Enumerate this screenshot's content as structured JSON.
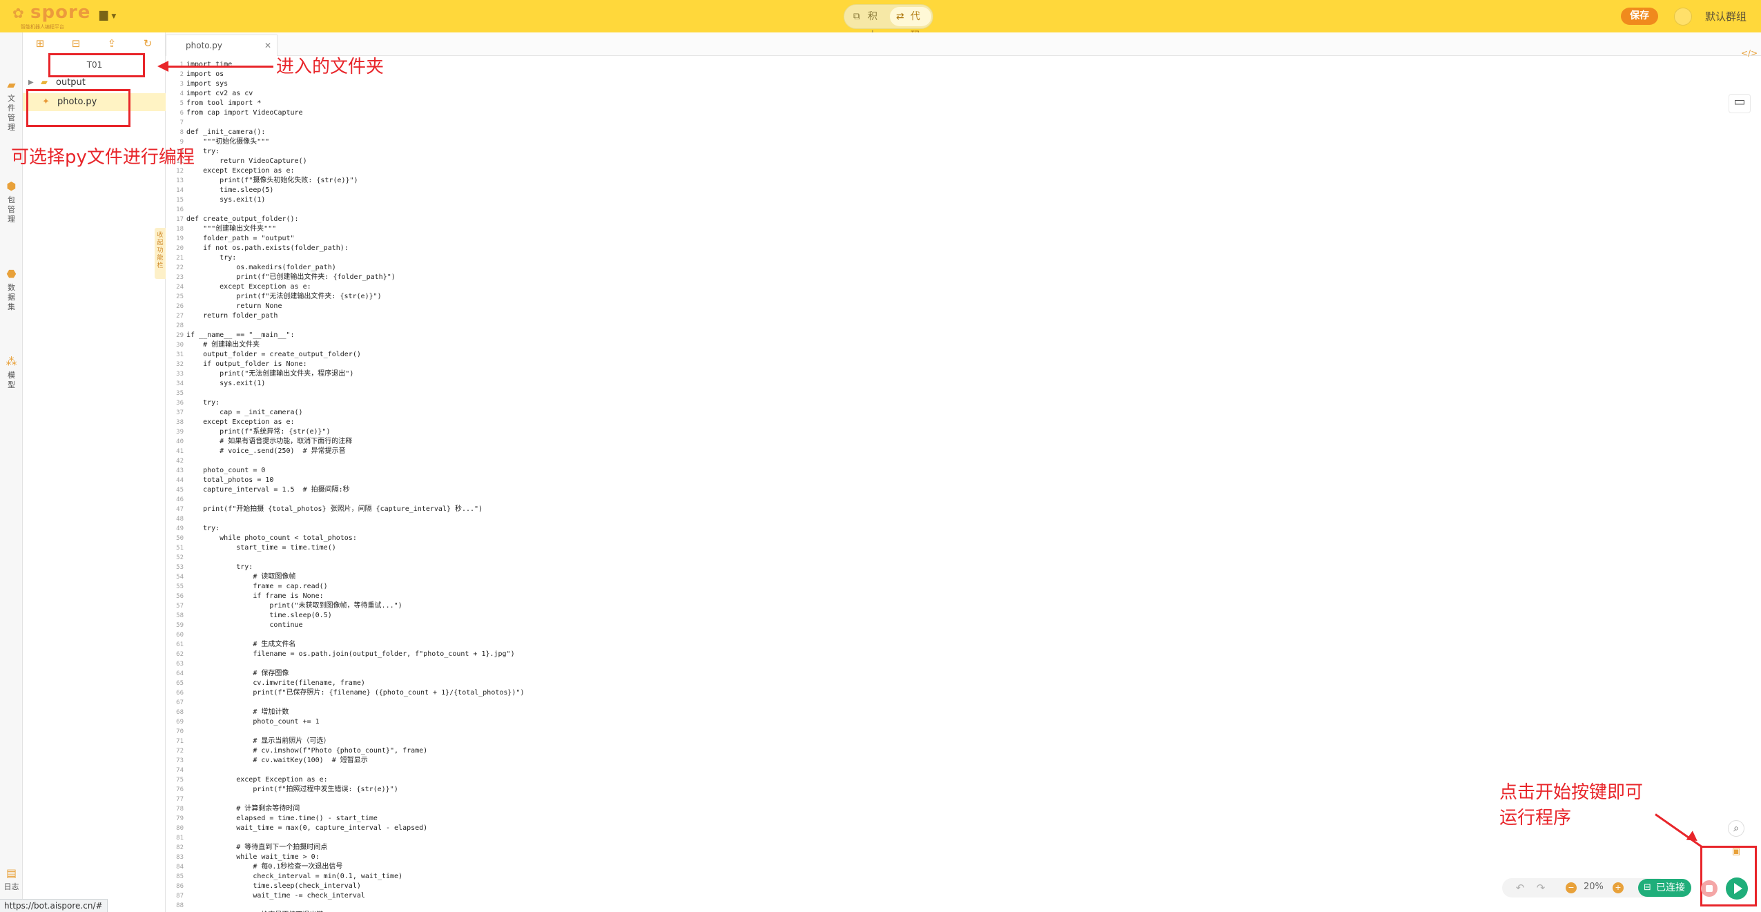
{
  "header": {
    "brand": "spore",
    "brand_sub": "智能机器人编程平台",
    "mode_blocks": "积木",
    "mode_code": "代码",
    "save_label": "保存",
    "group_label": "默认群组"
  },
  "rail": {
    "items": [
      {
        "label": "文件管理",
        "icon": "folder-icon"
      },
      {
        "label": "包管理",
        "icon": "package-icon"
      },
      {
        "label": "数据集",
        "icon": "dataset-icon"
      },
      {
        "label": "模型",
        "icon": "model-icon"
      }
    ],
    "log_label": "日志"
  },
  "files": {
    "project": "T01",
    "tree": [
      {
        "name": "output",
        "type": "folder"
      },
      {
        "name": "photo.py",
        "type": "file"
      }
    ],
    "collapse_label": "收起功能栏"
  },
  "editor": {
    "tab_name": "photo.py",
    "lines": [
      "import time",
      "import os",
      "import sys",
      "import cv2 as cv",
      "from tool import *",
      "from cap import VideoCapture",
      "",
      "def _init_camera():",
      "    \"\"\"初始化摄像头\"\"\"",
      "    try:",
      "        return VideoCapture()",
      "    except Exception as e:",
      "        print(f\"摄像头初始化失败: {str(e)}\")",
      "        time.sleep(5)",
      "        sys.exit(1)",
      "",
      "def create_output_folder():",
      "    \"\"\"创建输出文件夹\"\"\"",
      "    folder_path = \"output\"",
      "    if not os.path.exists(folder_path):",
      "        try:",
      "            os.makedirs(folder_path)",
      "            print(f\"已创建输出文件夹: {folder_path}\")",
      "        except Exception as e:",
      "            print(f\"无法创建输出文件夹: {str(e)}\")",
      "            return None",
      "    return folder_path",
      "",
      "if __name__ == \"__main__\":",
      "    # 创建输出文件夹",
      "    output_folder = create_output_folder()",
      "    if output_folder is None:",
      "        print(\"无法创建输出文件夹，程序退出\")",
      "        sys.exit(1)",
      "",
      "    try:",
      "        cap = _init_camera()",
      "    except Exception as e:",
      "        print(f\"系统异常: {str(e)}\")",
      "        # 如果有语音提示功能，取消下面行的注释",
      "        # voice_.send(250)  # 异常提示音",
      "",
      "    photo_count = 0",
      "    total_photos = 10",
      "    capture_interval = 1.5  # 拍摄间隔:秒",
      "",
      "    print(f\"开始拍摄 {total_photos} 张照片，间隔 {capture_interval} 秒...\")",
      "",
      "    try:",
      "        while photo_count < total_photos:",
      "            start_time = time.time()",
      "",
      "            try:",
      "                # 读取图像帧",
      "                frame = cap.read()",
      "                if frame is None:",
      "                    print(\"未获取到图像帧，等待重试...\")",
      "                    time.sleep(0.5)",
      "                    continue",
      "",
      "                # 生成文件名",
      "                filename = os.path.join(output_folder, f\"photo_count + 1}.jpg\")",
      "",
      "                # 保存图像",
      "                cv.imwrite(filename, frame)",
      "                print(f\"已保存照片: {filename} ({photo_count + 1}/{total_photos})\")",
      "",
      "                # 增加计数",
      "                photo_count += 1",
      "",
      "                # 显示当前照片（可选）",
      "                # cv.imshow(f\"Photo {photo_count}\", frame)",
      "                # cv.waitKey(100)  # 短暂显示",
      "",
      "            except Exception as e:",
      "                print(f\"拍照过程中发生错误: {str(e)}\")",
      "",
      "            # 计算剩余等待时间",
      "            elapsed = time.time() - start_time",
      "            wait_time = max(0, capture_interval - elapsed)",
      "",
      "            # 等待直到下一个拍摄时间点",
      "            while wait_time > 0:",
      "                # 每0.1秒检查一次退出信号",
      "                check_interval = min(0.1, wait_time)",
      "                time.sleep(check_interval)",
      "                wait_time -= check_interval",
      "",
      "                # 检查是否按下退出键"
    ]
  },
  "annotations": {
    "folder_note": "进入的文件夹",
    "file_note": "可选择py文件进行编程",
    "run_note_1": "点击开始按键即可",
    "run_note_2": "运行程序"
  },
  "controls": {
    "zoom": "20%",
    "connect_label": "已连接",
    "status_url": "https://bot.aispore.cn/#"
  },
  "colors": {
    "accent": "#ffd83b",
    "save": "#f08a1d",
    "connected": "#1fae7a",
    "annotation": "#e8252a"
  }
}
